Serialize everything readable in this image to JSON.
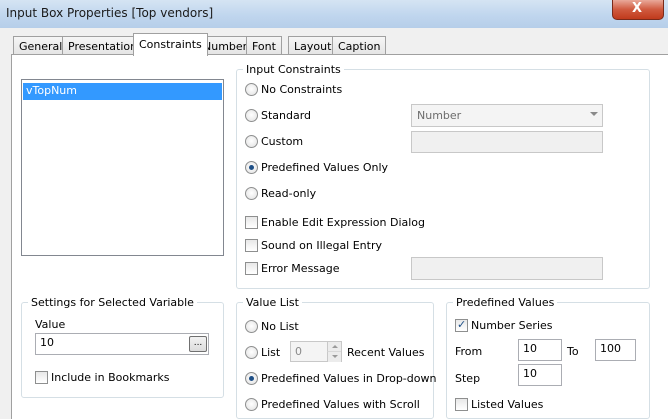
{
  "window": {
    "title": "Input Box Properties [Top vendors]",
    "close_label": "X"
  },
  "tabs": [
    "General",
    "Presentation",
    "Constraints",
    "Number",
    "Font",
    "Layout",
    "Caption"
  ],
  "active_tab": "Constraints",
  "variables": {
    "items": [
      "vTopNum"
    ],
    "selected": "vTopNum"
  },
  "input_constraints": {
    "title": "Input Constraints",
    "no_constraints": "No Constraints",
    "standard": "Standard",
    "standard_value": "Number",
    "custom": "Custom",
    "predefined_only": "Predefined Values Only",
    "read_only": "Read-only",
    "selected": "Predefined Values Only",
    "enable_edit_expression": "Enable Edit Expression Dialog",
    "sound_on_illegal": "Sound on Illegal Entry",
    "error_message": "Error Message"
  },
  "settings": {
    "title": "Settings for Selected Variable",
    "value_label": "Value",
    "value": "10",
    "browse_label": "...",
    "include_bookmarks": "Include in Bookmarks"
  },
  "value_list": {
    "title": "Value List",
    "no_list": "No List",
    "list": "List",
    "recent_count": "0",
    "recent_values": "Recent Values",
    "predefined_dropdown": "Predefined Values in Drop-down",
    "predefined_scroll": "Predefined Values with Scroll",
    "selected": "Predefined Values in Drop-down"
  },
  "predefined_values": {
    "title": "Predefined Values",
    "number_series": "Number Series",
    "number_series_checked": true,
    "from_label": "From",
    "from_value": "10",
    "to_label": "To",
    "to_value": "100",
    "step_label": "Step",
    "step_value": "10",
    "listed_values": "Listed Values",
    "listed_values_checked": false
  },
  "colors": {
    "selection": "#3399ff",
    "titlebar": "#c0d6ee",
    "close": "#c03a1c"
  }
}
